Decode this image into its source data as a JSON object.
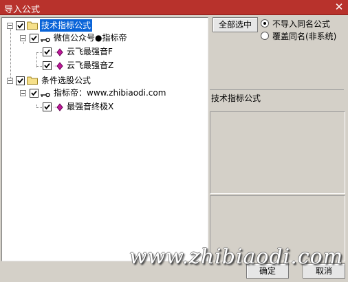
{
  "window": {
    "title": "导入公式",
    "close_glyph": "✕"
  },
  "tree": {
    "nodes": [
      {
        "label": "技术指标公式",
        "checked": true,
        "type": "folder",
        "selected": true
      },
      {
        "label": "微信公众号●指标帝",
        "checked": true,
        "type": "key"
      },
      {
        "label": "云飞最强音F",
        "checked": true,
        "type": "formula"
      },
      {
        "label": "云飞最强音Z",
        "checked": true,
        "type": "formula"
      },
      {
        "label": "条件选股公式",
        "checked": true,
        "type": "folder"
      },
      {
        "label": "指标帝：www.zhibiaodi.com",
        "checked": true,
        "type": "key"
      },
      {
        "label": "最强音终极X",
        "checked": true,
        "type": "formula"
      }
    ]
  },
  "options": {
    "select_all_label": "全部选中",
    "radio_no_import": "不导入同名公式",
    "radio_overwrite": "覆盖同名(非系统)",
    "selected_radio": "不导入同名公式"
  },
  "info": {
    "category_label": "技术指标公式"
  },
  "footer": {
    "ok_label": "确定",
    "cancel_label": "取消"
  },
  "watermark": {
    "text": "www.zhibiaodi.com"
  },
  "colors": {
    "titlebar": "#b8322c",
    "selection": "#0a64d8",
    "formula_icon": "#c0189a"
  }
}
